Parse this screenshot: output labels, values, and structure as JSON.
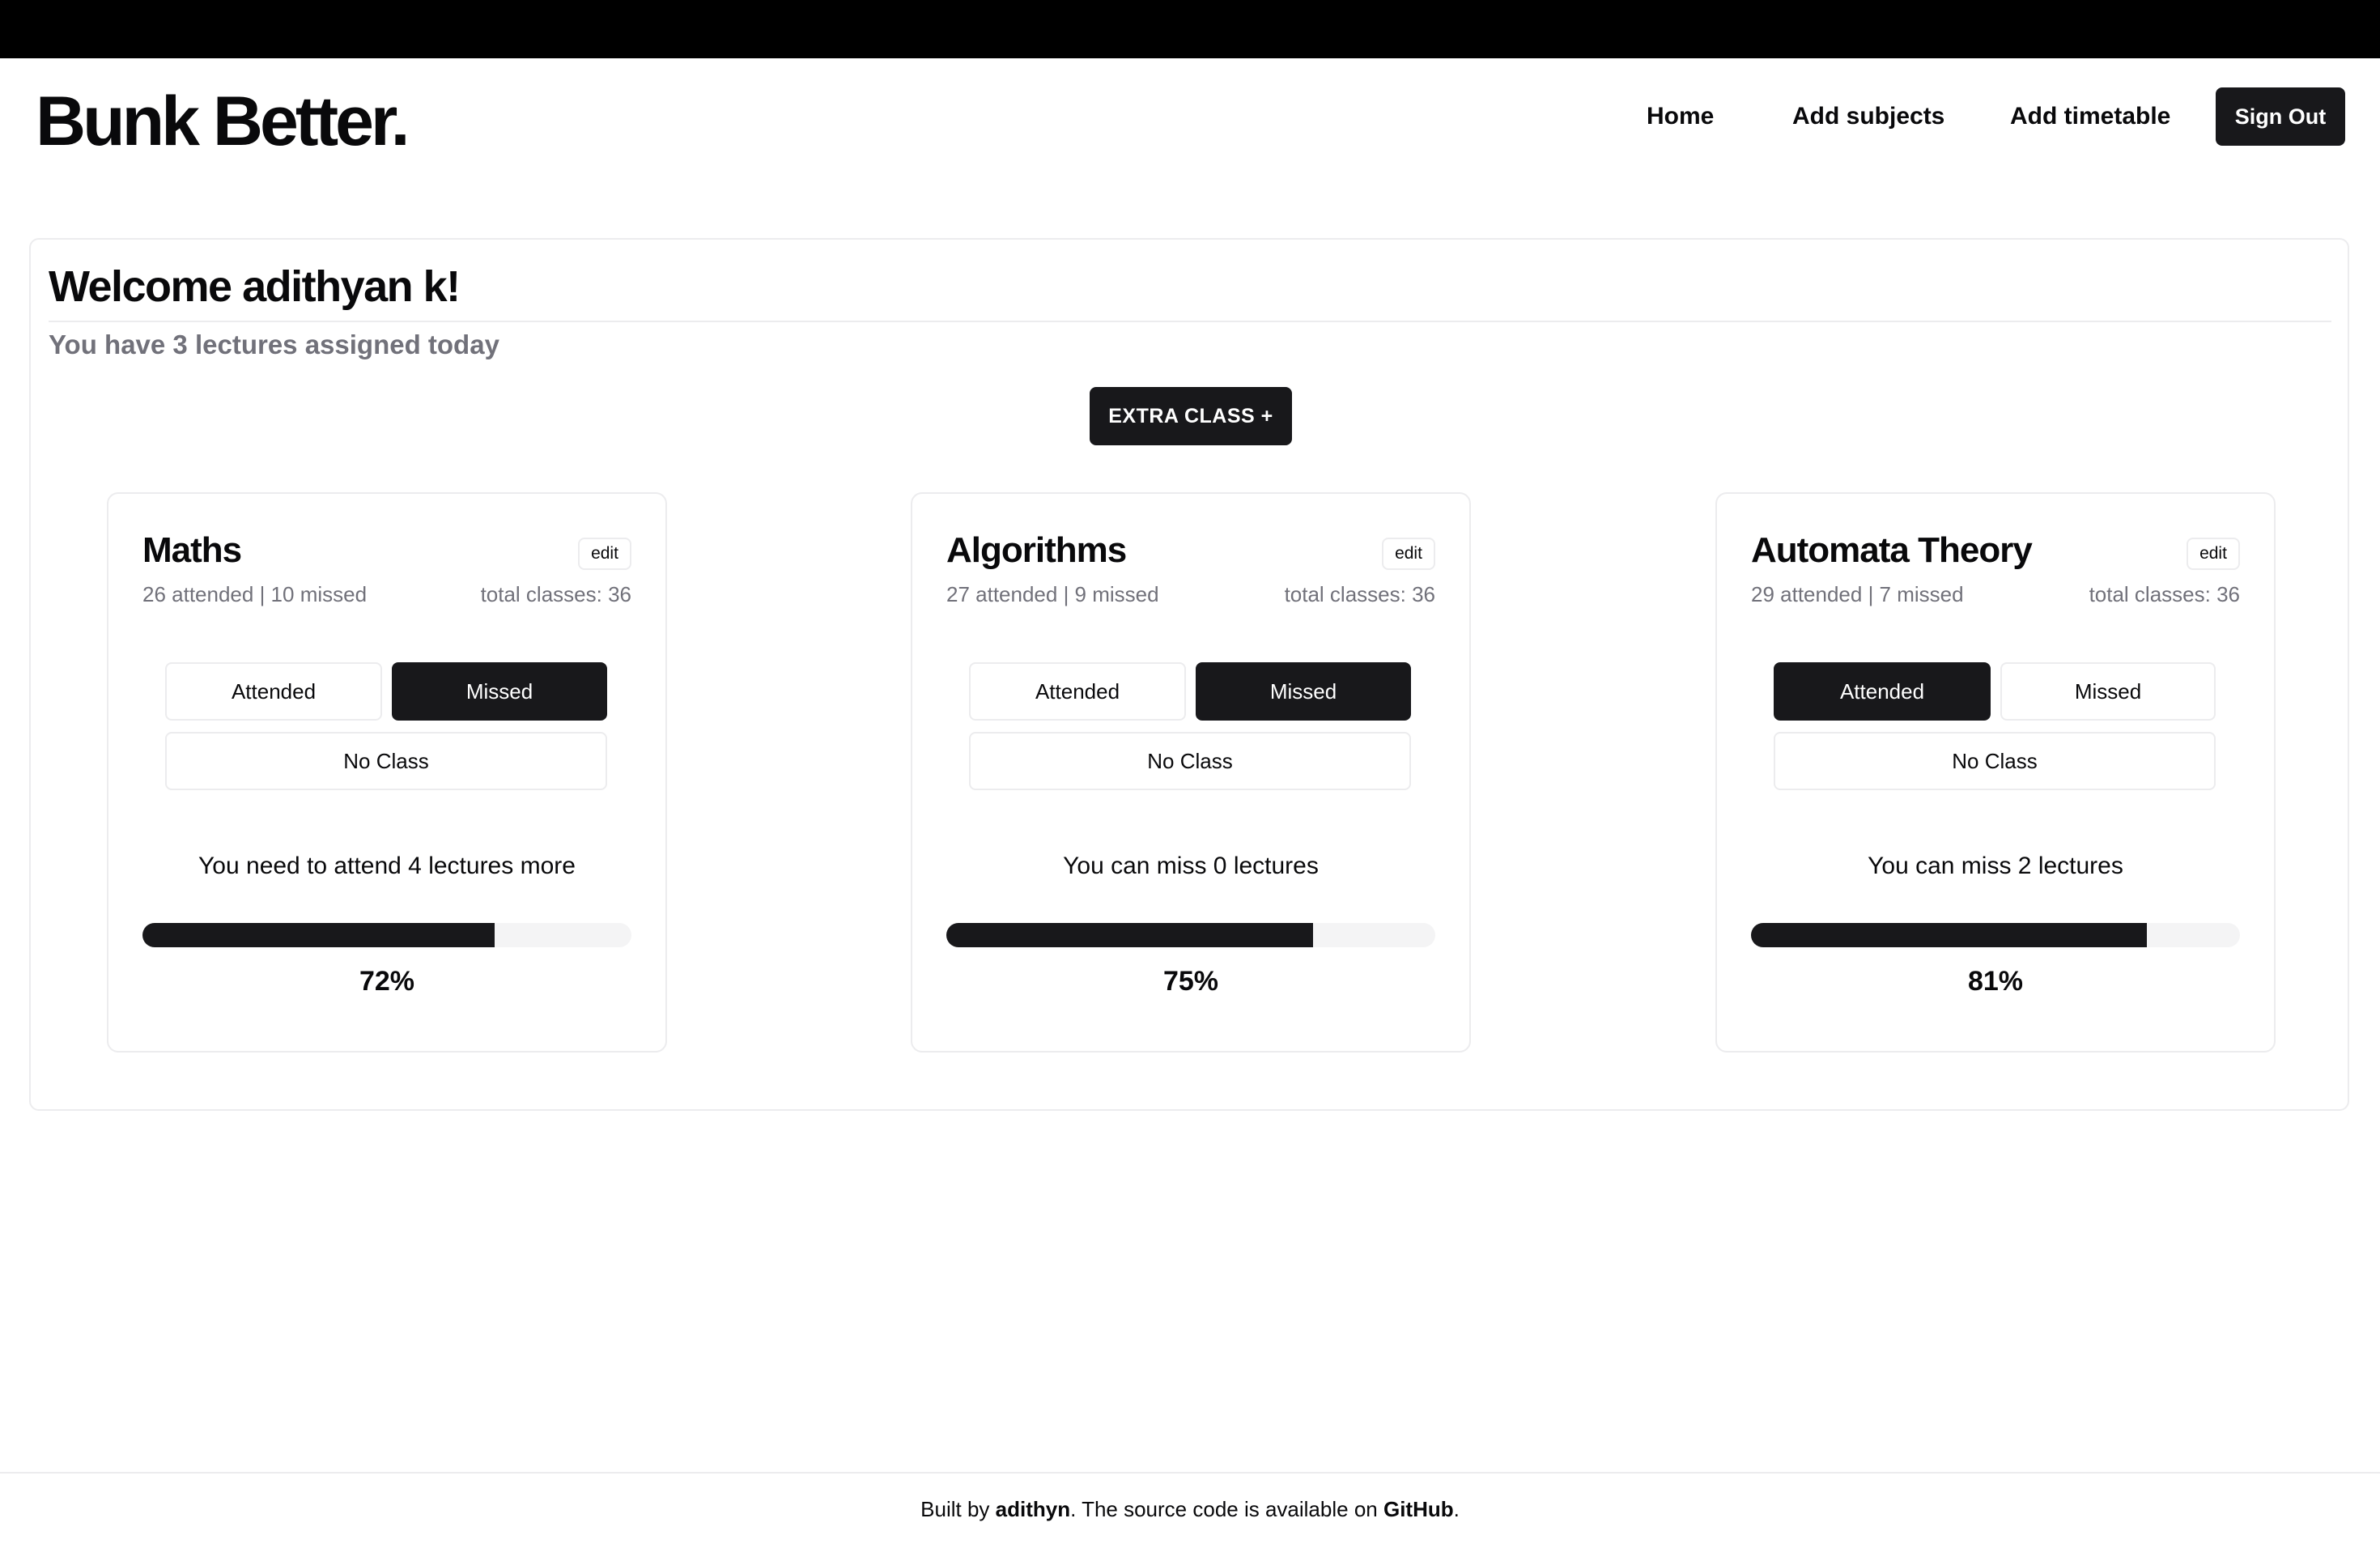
{
  "header": {
    "logo": "Bunk Better.",
    "nav": {
      "home": "Home",
      "add_subjects": "Add subjects",
      "add_timetable": "Add timetable",
      "sign_out": "Sign Out"
    }
  },
  "dashboard": {
    "welcome": "Welcome adithyan k!",
    "subtitle": "You have 3 lectures assigned today",
    "extra_class": "EXTRA CLASS +"
  },
  "buttons": {
    "edit": "edit",
    "attended": "Attended",
    "missed": "Missed",
    "no_class": "No Class"
  },
  "subjects": [
    {
      "name": "Maths",
      "stats": "26 attended | 10 missed",
      "total": "total classes: 36",
      "selected": "Missed",
      "message": "You need to attend 4 lectures more",
      "percent": 72,
      "percent_label": "72%"
    },
    {
      "name": "Algorithms",
      "stats": "27 attended | 9 missed",
      "total": "total classes: 36",
      "selected": "Missed",
      "message": "You can miss 0 lectures",
      "percent": 75,
      "percent_label": "75%"
    },
    {
      "name": "Automata Theory",
      "stats": "29 attended | 7 missed",
      "total": "total classes: 36",
      "selected": "Attended",
      "message": "You can miss 2 lectures",
      "percent": 81,
      "percent_label": "81%"
    }
  ],
  "footer": {
    "prefix": "Built by ",
    "author": "adithyn",
    "middle": ". The source code is available on ",
    "link": "GitHub",
    "suffix": "."
  },
  "colors": {
    "accent": "#18181b",
    "muted_text": "#71717a",
    "border": "#ececee",
    "track": "#f4f4f5",
    "topbar": "#000000"
  }
}
